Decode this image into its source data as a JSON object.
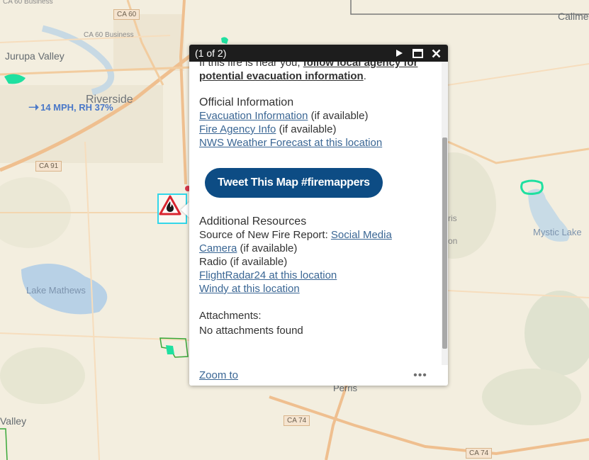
{
  "map": {
    "labels": {
      "business_top": "CA 60 Business",
      "business_mid": "CA 60 Business",
      "jurupa_valley": "Jurupa Valley",
      "riverside": "Riverside",
      "lake_mathews": "Lake Mathews",
      "valley": "Valley",
      "perris": "Perris",
      "perris_partial": "ris",
      "on_partial": "on",
      "mystic_lake": "Mystic Lake",
      "calimesa_partial": "Calime"
    },
    "shields": {
      "ca60": "CA 60",
      "ca91": "CA 91",
      "ca74_a": "CA 74",
      "ca74_b": "CA 74"
    },
    "wind": {
      "text": "14 MPH, RH 37%"
    }
  },
  "popup": {
    "counter": "(1 of 2)",
    "intro_prefix": "If this fire is near you,",
    "intro_link": "follow local agency for potential evacuation information",
    "intro_suffix": ".",
    "official_heading": "Official Information",
    "evac_link": "Evacuation Information",
    "evac_note": "(if available)",
    "agency_link": "Fire Agency Info",
    "agency_note": "(if available)",
    "nws_link": "NWS Weather Forecast at this location",
    "tweet_button": "Tweet This Map #firemappers",
    "additional_heading": "Additional Resources",
    "source_prefix": "Source of New Fire Report:",
    "source_link": "Social Media",
    "camera_link": "Camera",
    "camera_note": "(if available)",
    "radio_text": "Radio (if available)",
    "flightradar_link": "FlightRadar24 at this location",
    "windy_link": "Windy at this location",
    "attachments_heading": "Attachments:",
    "attachments_text": "No attachments found",
    "zoom_link": "Zoom to",
    "more_icon": "•••"
  }
}
